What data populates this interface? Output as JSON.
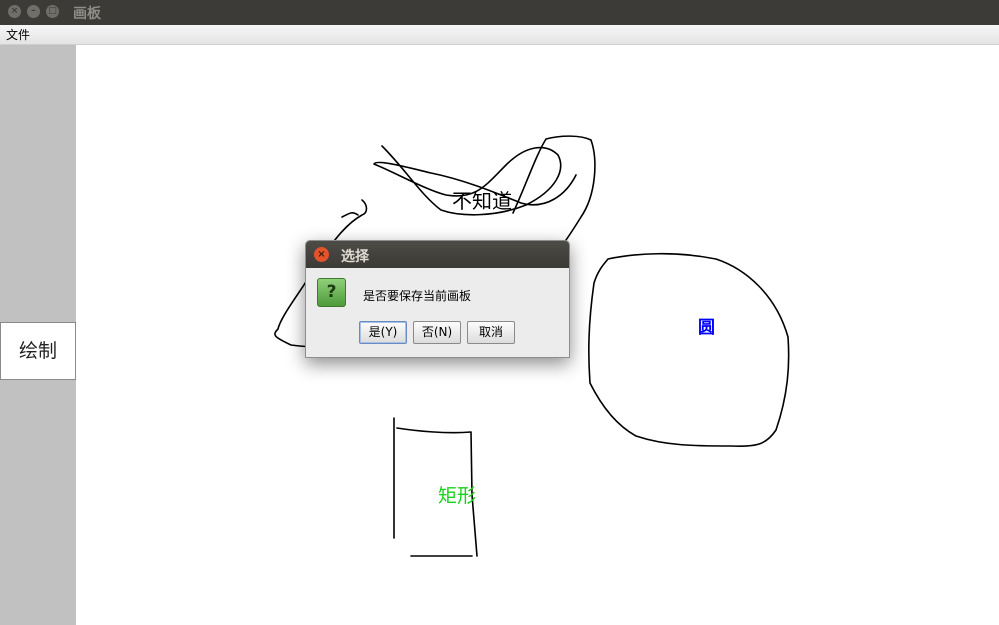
{
  "window": {
    "title": "画板"
  },
  "menu": {
    "file_label": "文件"
  },
  "sidebar": {
    "draw_button": "绘制"
  },
  "canvas": {
    "labels": {
      "unknown": "不知道",
      "circle": "圆",
      "rect": "矩形"
    },
    "colors": {
      "circle_label": "#0000ff",
      "rect_label": "#19d219",
      "unknown_label": "#000000"
    }
  },
  "dialog": {
    "title": "选择",
    "icon": "question-icon",
    "message": "是否要保存当前画板",
    "yes": "是(Y)",
    "no": "否(N)",
    "cancel": "取消"
  }
}
